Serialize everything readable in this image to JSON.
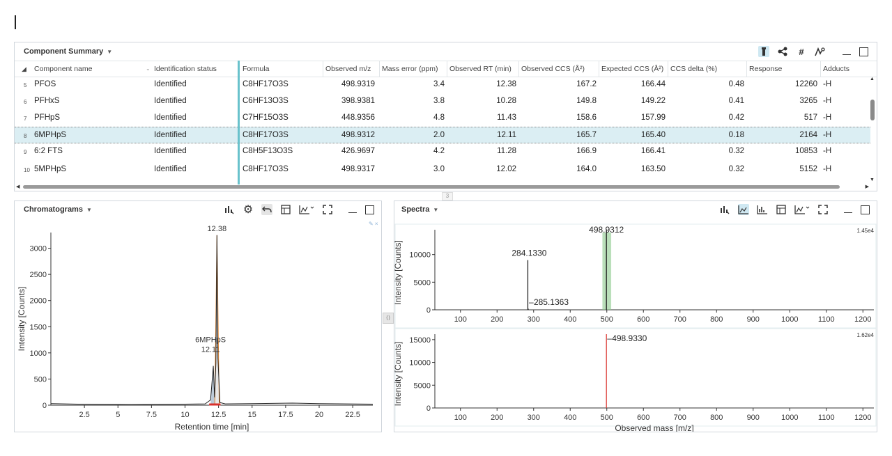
{
  "component_summary": {
    "title": "Component Summary",
    "columns": [
      "Component name",
      "Identification status",
      "Formula",
      "Observed m/z",
      "Mass error (ppm)",
      "Observed RT (min)",
      "Observed CCS (Å²)",
      "Expected CCS (Å²)",
      "CCS delta (%)",
      "Response",
      "Adducts"
    ],
    "rows": [
      {
        "index": "5",
        "name": "PFOS",
        "status": "Identified",
        "formula": "C8HF17O3S",
        "mz": "498.9319",
        "mass_error": "3.4",
        "rt": "12.38",
        "obs_ccs": "167.2",
        "exp_ccs": "166.44",
        "ccs_delta": "0.48",
        "response": "12260",
        "adducts": "-H"
      },
      {
        "index": "6",
        "name": "PFHxS",
        "status": "Identified",
        "formula": "C6HF13O3S",
        "mz": "398.9381",
        "mass_error": "3.8",
        "rt": "10.28",
        "obs_ccs": "149.8",
        "exp_ccs": "149.22",
        "ccs_delta": "0.41",
        "response": "3265",
        "adducts": "-H"
      },
      {
        "index": "7",
        "name": "PFHpS",
        "status": "Identified",
        "formula": "C7HF15O3S",
        "mz": "448.9356",
        "mass_error": "4.8",
        "rt": "11.43",
        "obs_ccs": "158.6",
        "exp_ccs": "157.99",
        "ccs_delta": "0.42",
        "response": "517",
        "adducts": "-H"
      },
      {
        "index": "8",
        "name": "6MPHpS",
        "status": "Identified",
        "formula": "C8HF17O3S",
        "mz": "498.9312",
        "mass_error": "2.0",
        "rt": "12.11",
        "obs_ccs": "165.7",
        "exp_ccs": "165.40",
        "ccs_delta": "0.18",
        "response": "2164",
        "adducts": "-H"
      },
      {
        "index": "9",
        "name": "6:2 FTS",
        "status": "Identified",
        "formula": "C8H5F13O3S",
        "mz": "426.9697",
        "mass_error": "4.2",
        "rt": "11.28",
        "obs_ccs": "166.9",
        "exp_ccs": "166.41",
        "ccs_delta": "0.32",
        "response": "10853",
        "adducts": "-H"
      },
      {
        "index": "10",
        "name": "5MPHpS",
        "status": "Identified",
        "formula": "C8HF17O3S",
        "mz": "498.9317",
        "mass_error": "3.0",
        "rt": "12.02",
        "obs_ccs": "164.0",
        "exp_ccs": "163.50",
        "ccs_delta": "0.32",
        "response": "5152",
        "adducts": "-H"
      }
    ],
    "selected_index": 3,
    "toolbar_icons": [
      "filter-icon",
      "share-icon",
      "hash-icon",
      "peak-icon"
    ]
  },
  "splitter_label": "3",
  "chromatograms": {
    "title": "Chromatograms",
    "toolbar_icons": [
      "bar-icon",
      "gear-icon",
      "undo-icon",
      "table-icon",
      "chart-icon",
      "expand-icon"
    ]
  },
  "spectra": {
    "title": "Spectra",
    "toolbar_icons": [
      "bar-icon",
      "chart-icon",
      "chart-alt-icon",
      "table-icon",
      "chart-icon",
      "expand-icon"
    ]
  },
  "colors": {
    "accent": "#69c2cc",
    "selected_row": "#dbeef3",
    "peak_highlight": "#8cc98c",
    "orange": "#e3852e",
    "red": "#d9302c"
  },
  "chart_data": [
    {
      "type": "line",
      "xlabel": "Retention time [min]",
      "ylabel": "Intensity [Counts]",
      "xlim": [
        0,
        24
      ],
      "ylim": [
        0,
        3300
      ],
      "xticks": [
        2.5,
        5,
        7.5,
        10,
        12.5,
        15,
        17.5,
        20,
        22.5
      ],
      "yticks": [
        0,
        500,
        1000,
        1500,
        2000,
        2500,
        3000
      ],
      "series": [
        {
          "x": [
            0,
            2,
            4,
            6,
            8,
            10,
            11.5,
            11.9,
            12.0,
            12.11,
            12.2,
            12.3,
            12.38,
            12.45,
            12.6,
            13,
            15,
            18,
            20,
            22,
            24
          ],
          "y": [
            30,
            20,
            15,
            12,
            15,
            20,
            25,
            100,
            400,
            750,
            150,
            800,
            3250,
            900,
            50,
            25,
            30,
            40,
            30,
            25,
            20
          ]
        }
      ],
      "annotations": [
        {
          "x": 12.38,
          "y": 3250,
          "text": "12.38"
        },
        {
          "x": 12.11,
          "y": 750,
          "text": "6MPHpS\n12.11"
        }
      ]
    },
    {
      "type": "bar",
      "ylabel": "Intensity [Counts]",
      "xlim": [
        30,
        1230
      ],
      "ylim": [
        0,
        14500
      ],
      "xticks": [
        100,
        200,
        300,
        400,
        500,
        600,
        700,
        800,
        900,
        1000,
        1100,
        1200
      ],
      "yticks": [
        0,
        5000,
        10000
      ],
      "scale_label": "1.45e4",
      "x": [
        284.133,
        285.1363,
        498.9312
      ],
      "y": [
        9000,
        200,
        14500
      ],
      "annotations": [
        {
          "x": 284.133,
          "text": "284.1330"
        },
        {
          "x": 285.1363,
          "text": "285.1363"
        },
        {
          "x": 498.9312,
          "text": "498.9312"
        }
      ]
    },
    {
      "type": "bar",
      "xlabel": "Observed mass [m/z]",
      "ylabel": "Intensity [Counts]",
      "xlim": [
        30,
        1230
      ],
      "ylim": [
        0,
        16200
      ],
      "xticks": [
        100,
        200,
        300,
        400,
        500,
        600,
        700,
        800,
        900,
        1000,
        1100,
        1200
      ],
      "yticks": [
        0,
        5000,
        10000,
        15000
      ],
      "scale_label": "1.62e4",
      "x": [
        498.933
      ],
      "y": [
        16200
      ],
      "annotations": [
        {
          "x": 498.933,
          "text": "498.9330"
        }
      ]
    }
  ]
}
